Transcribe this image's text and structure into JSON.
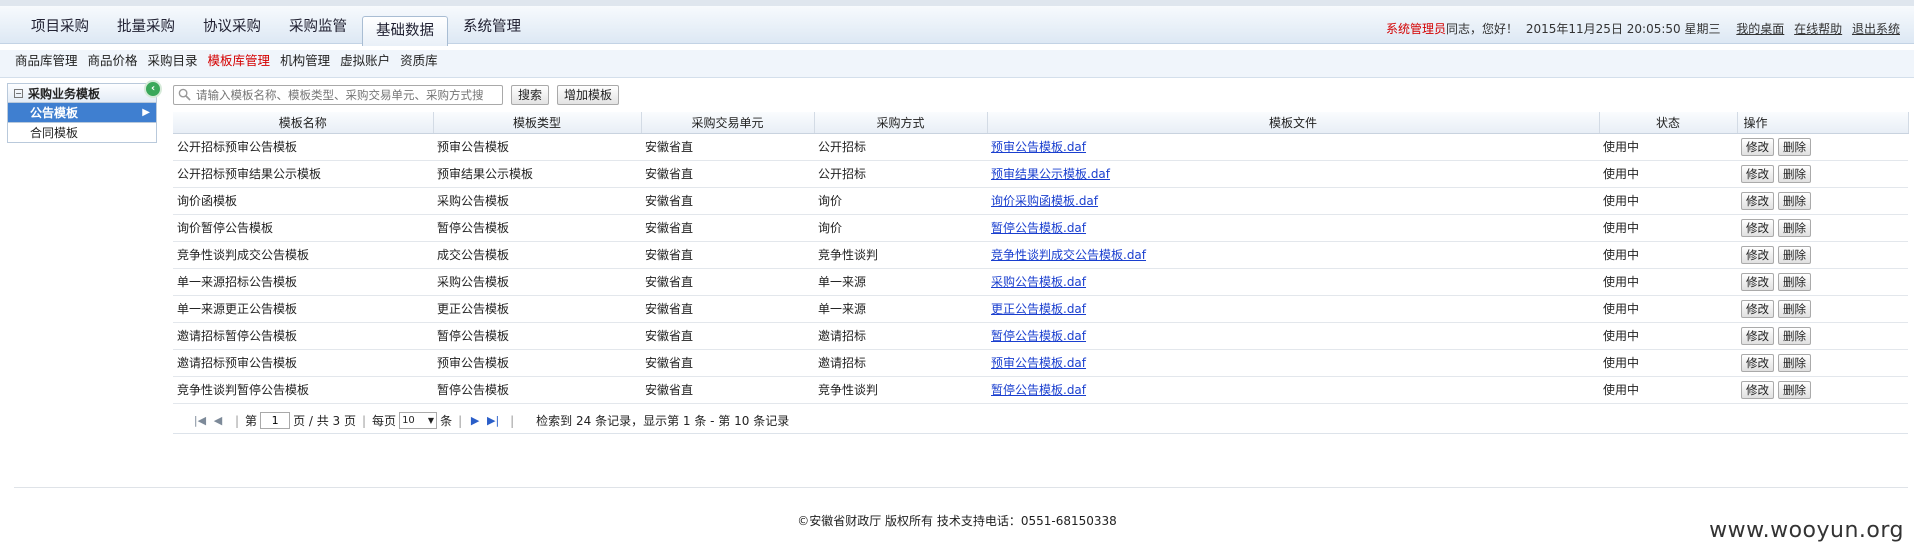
{
  "main_nav": [
    {
      "label": "项目采购"
    },
    {
      "label": "批量采购"
    },
    {
      "label": "协议采购"
    },
    {
      "label": "采购监管"
    },
    {
      "label": "基础数据"
    },
    {
      "label": "系统管理"
    }
  ],
  "active_main_nav": "基础数据",
  "user": {
    "role": "系统管理员",
    "greeting": "同志，您好！",
    "datetime": "2015年11月25日 20:05:50 星期三",
    "links": [
      "我的桌面",
      "在线帮助",
      "退出系统"
    ]
  },
  "sub_nav": [
    {
      "label": "商品库管理"
    },
    {
      "label": "商品价格"
    },
    {
      "label": "采购目录"
    },
    {
      "label": "模板库管理"
    },
    {
      "label": "机构管理"
    },
    {
      "label": "虚拟账户"
    },
    {
      "label": "资质库"
    }
  ],
  "active_sub_nav": "模板库管理",
  "sidebar": {
    "title": "采购业务模板",
    "items": [
      {
        "label": "公告模板"
      },
      {
        "label": "合同模板"
      }
    ]
  },
  "search": {
    "placeholder": "请输入模板名称、模板类型、采购交易单元、采购方式搜",
    "search_label": "搜索",
    "add_label": "增加模板"
  },
  "table": {
    "headers": [
      "模板名称",
      "模板类型",
      "采购交易单元",
      "采购方式",
      "模板文件",
      "状态",
      "操作"
    ],
    "edit_label": "修改",
    "delete_label": "删除",
    "rows": [
      [
        "公开招标预审公告模板",
        "预审公告模板",
        "安徽省直",
        "公开招标",
        "预审公告模板.daf",
        "使用中"
      ],
      [
        "公开招标预审结果公示模板",
        "预审结果公示模板",
        "安徽省直",
        "公开招标",
        "预审结果公示模板.daf",
        "使用中"
      ],
      [
        "询价函模板",
        "采购公告模板",
        "安徽省直",
        "询价",
        "询价采购函模板.daf",
        "使用中"
      ],
      [
        "询价暂停公告模板",
        "暂停公告模板",
        "安徽省直",
        "询价",
        "暂停公告模板.daf",
        "使用中"
      ],
      [
        "竞争性谈判成交公告模板",
        "成交公告模板",
        "安徽省直",
        "竞争性谈判",
        "竞争性谈判成交公告模板.daf",
        "使用中"
      ],
      [
        "单一来源招标公告模板",
        "采购公告模板",
        "安徽省直",
        "单一来源",
        "采购公告模板.daf",
        "使用中"
      ],
      [
        "单一来源更正公告模板",
        "更正公告模板",
        "安徽省直",
        "单一来源",
        "更正公告模板.daf",
        "使用中"
      ],
      [
        "邀请招标暂停公告模板",
        "暂停公告模板",
        "安徽省直",
        "邀请招标",
        "暂停公告模板.daf",
        "使用中"
      ],
      [
        "邀请招标预审公告模板",
        "预审公告模板",
        "安徽省直",
        "邀请招标",
        "预审公告模板.daf",
        "使用中"
      ],
      [
        "竞争性谈判暂停公告模板",
        "暂停公告模板",
        "安徽省直",
        "竞争性谈判",
        "暂停公告模板.daf",
        "使用中"
      ]
    ]
  },
  "pager": {
    "page_prefix": "第",
    "current_page": "1",
    "page_suffix": "页 / 共 3 页",
    "per_page_prefix": "每页",
    "per_page": "10",
    "per_page_suffix": "条",
    "summary": "检索到 24 条记录，显示第 1 条 - 第 10 条记录"
  },
  "footer": "©安徽省财政厅 版权所有 技术支持电话：0551-68150338",
  "watermark": "www.wooyun.org"
}
